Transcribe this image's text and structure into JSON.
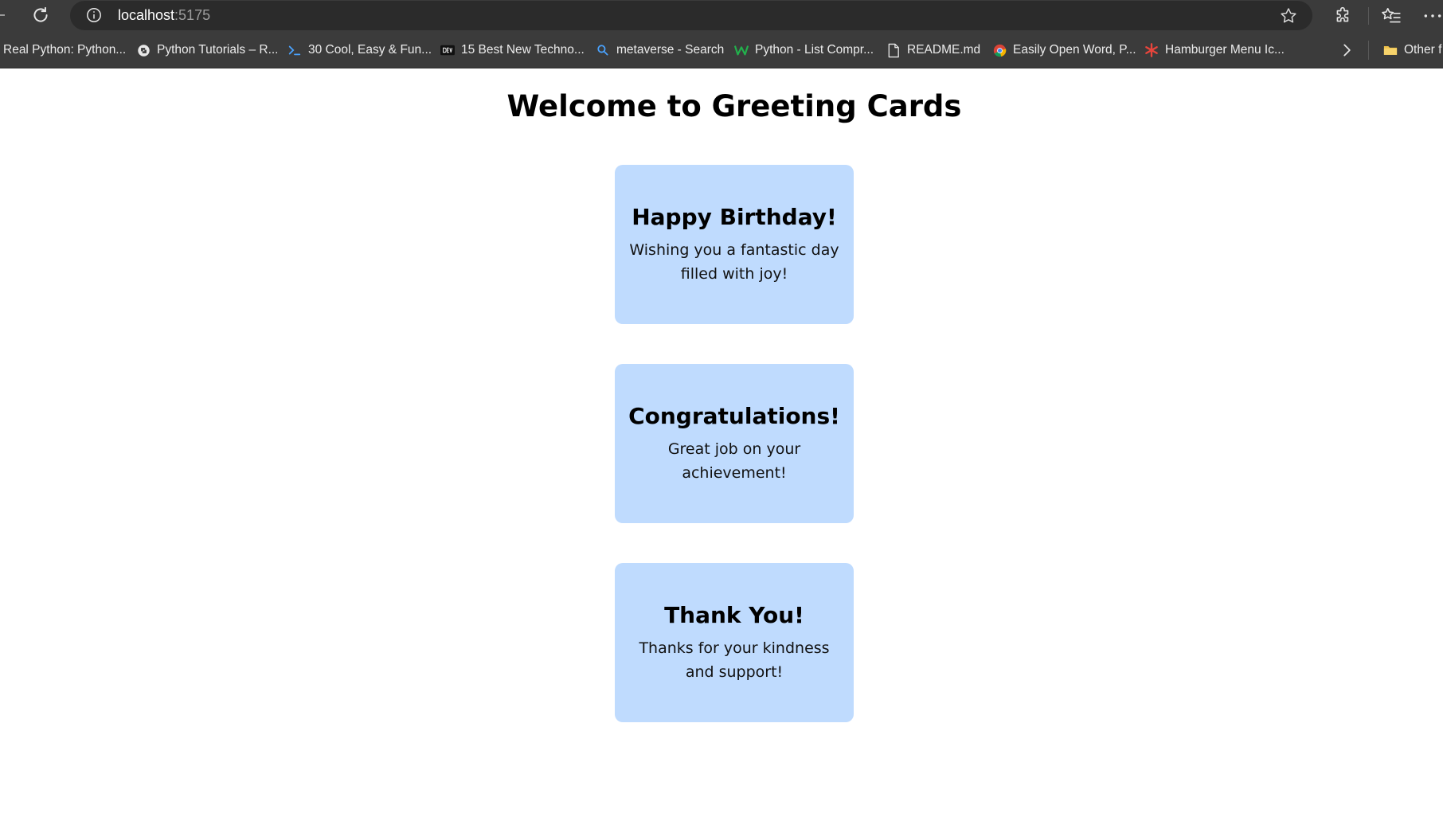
{
  "browser": {
    "url_host": "localhost",
    "url_port": ":5175",
    "bookmarks": [
      {
        "label": "Real Python: Python...",
        "icon": "none"
      },
      {
        "label": "Python Tutorials – R...",
        "icon": "python-logo-icon"
      },
      {
        "label": "30 Cool, Easy & Fun...",
        "icon": "terminal-prompt-icon"
      },
      {
        "label": "15 Best New Techno...",
        "icon": "dev-logo-icon"
      },
      {
        "label": "metaverse - Search",
        "icon": "search-icon"
      },
      {
        "label": "Python - List Compr...",
        "icon": "w-logo-icon"
      },
      {
        "label": "README.md",
        "icon": "document-icon"
      },
      {
        "label": "Easily Open Word, P...",
        "icon": "chrome-logo-icon"
      },
      {
        "label": "Hamburger Menu Ic...",
        "icon": "asterisk-logo-icon"
      }
    ],
    "other_favorites": "Other f"
  },
  "page": {
    "title": "Welcome to Greeting Cards",
    "cards": [
      {
        "title": "Happy Birthday!",
        "message": "Wishing you a fantastic day filled with joy!"
      },
      {
        "title": "Congratulations!",
        "message": "Great job on your achievement!"
      },
      {
        "title": "Thank You!",
        "message": "Thanks for your kindness and support!"
      }
    ]
  },
  "colors": {
    "card_background": "#bfdbfe",
    "chrome_background": "#3b3b3b",
    "omnibox_background": "#2b2b2b"
  }
}
